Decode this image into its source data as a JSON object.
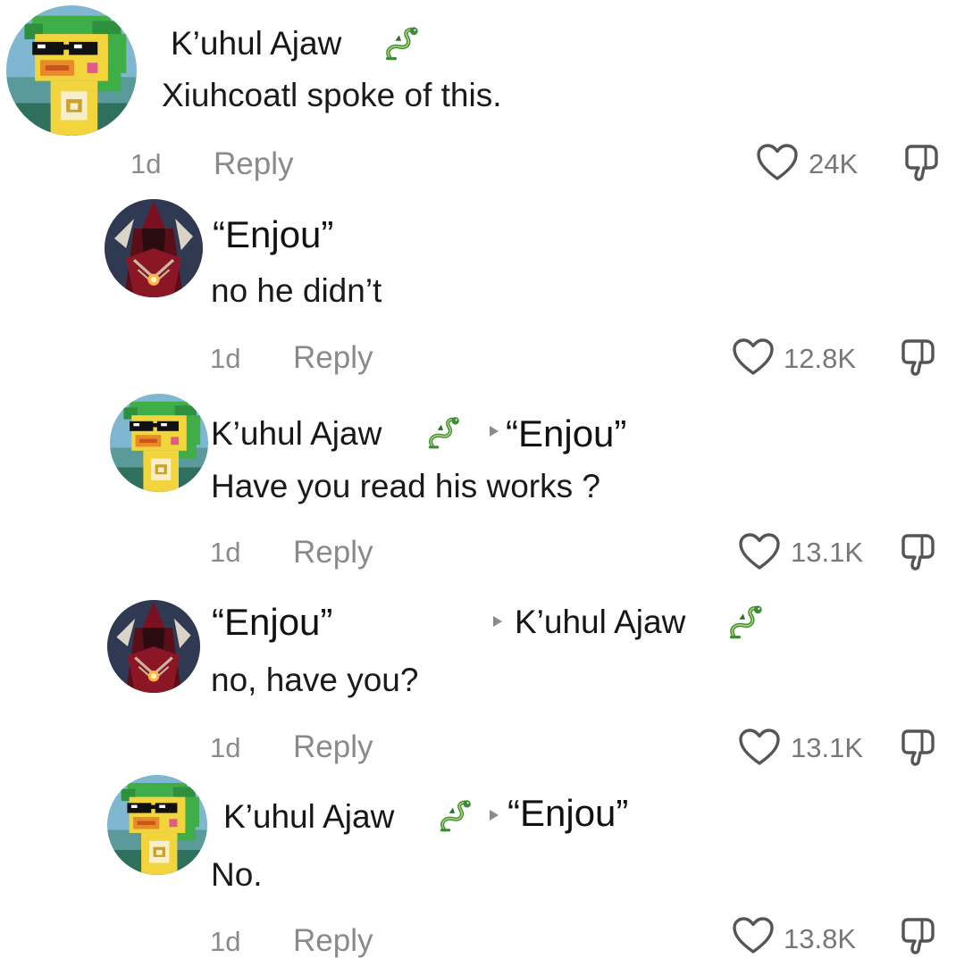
{
  "comments": [
    {
      "username": "K’uhul Ajaw",
      "username_emoji": "dragon-icon",
      "text": "Xiuhcoatl spoke of this.",
      "time": "1d",
      "reply_label": "Reply",
      "likes": "24K"
    },
    {
      "username": "“Enjou”",
      "text": "no he didn’t",
      "time": "1d",
      "reply_label": "Reply",
      "likes": "12.8K"
    },
    {
      "username": "K’uhul Ajaw",
      "username_emoji": "dragon-icon",
      "reply_to": "“Enjou”",
      "text": "Have you read his works ?",
      "time": "1d",
      "reply_label": "Reply",
      "likes": "13.1K"
    },
    {
      "username": "“Enjou”",
      "reply_to": "K’uhul Ajaw",
      "reply_to_emoji": "dragon-icon",
      "text": "no, have you?",
      "time": "1d",
      "reply_label": "Reply",
      "likes": "13.1K"
    },
    {
      "username": "K’uhul Ajaw",
      "username_emoji": "dragon-icon",
      "reply_to": "“Enjou”",
      "text": "No.",
      "time": "1d",
      "reply_label": "Reply",
      "likes": "13.8K"
    }
  ],
  "icons": {
    "like": "heart-outline-icon",
    "dislike": "thumbs-down-outline-icon",
    "reply_arrow": "play-triangle-icon"
  },
  "colors": {
    "meta_gray": "#8a8a8a",
    "icon_gray": "#555555",
    "duck_yellow": "#f2d53c",
    "duck_green": "#3fae49"
  }
}
